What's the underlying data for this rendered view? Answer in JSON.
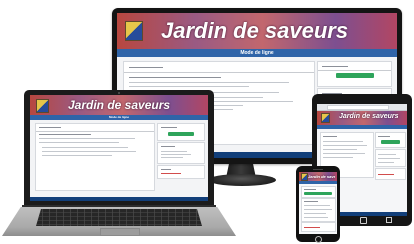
{
  "site": {
    "name": "Jardin de saveurs",
    "page_title": "Mode de ligne"
  },
  "colors": {
    "banner_purple": "#8f5b86",
    "nav_blue": "#2f64a8",
    "footer_blue": "#123f7a",
    "accent_green": "#2ea45b",
    "alert_red": "#d24c4c"
  },
  "devices": [
    "desktop-monitor",
    "laptop",
    "tablet",
    "smartphone"
  ],
  "icons": {
    "laptop_camera": "webcam-icon",
    "tablet_home": "home-button-icon",
    "phone_home": "home-button-icon"
  }
}
